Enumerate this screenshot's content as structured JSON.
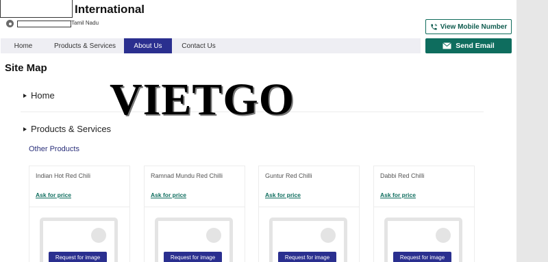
{
  "header": {
    "company_name": "International",
    "address_text": "Tamil Nadu",
    "view_mobile_label": "View Mobile Number",
    "send_email_label": "Send Email"
  },
  "nav": {
    "items": [
      {
        "label": "Home",
        "active": false
      },
      {
        "label": "Products & Services",
        "active": false
      },
      {
        "label": "About Us",
        "active": true
      },
      {
        "label": "Contact Us",
        "active": false
      }
    ]
  },
  "main": {
    "page_title": "Site Map",
    "sections": [
      {
        "label": "Home"
      },
      {
        "label": "Products & Services"
      }
    ],
    "subheading": "Other Products",
    "watermark": "VIETGO"
  },
  "products": [
    {
      "name": "Indian Hot Red Chili",
      "price_label": "Ask for price",
      "button_label": "Request for image"
    },
    {
      "name": "Ramnad Mundu Red Chilli",
      "price_label": "Ask for price",
      "button_label": "Request for image"
    },
    {
      "name": "Guntur Red Chilli",
      "price_label": "Ask for price",
      "button_label": "Request for image"
    },
    {
      "name": "Dabbi Red Chilli",
      "price_label": "Ask for price",
      "button_label": "Request for image"
    }
  ],
  "colors": {
    "brand_green": "#0e6d5e",
    "nav_active": "#2a2f8f",
    "gutter": "#e7e7e7"
  }
}
